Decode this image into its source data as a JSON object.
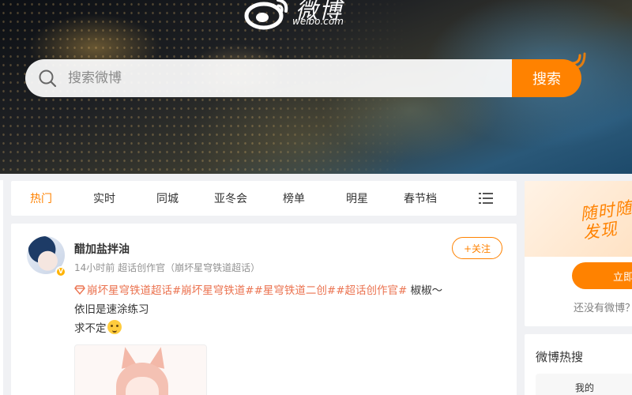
{
  "header": {
    "logo_cn": "微博",
    "logo_en": "weibo.com",
    "search_placeholder": "搜索微博",
    "search_button": "搜索"
  },
  "tabs": [
    {
      "label": "热门",
      "active": true
    },
    {
      "label": "实时",
      "active": false
    },
    {
      "label": "同城",
      "active": false
    },
    {
      "label": "亚冬会",
      "active": false
    },
    {
      "label": "榜单",
      "active": false
    },
    {
      "label": "明星",
      "active": false
    },
    {
      "label": "春节档",
      "active": false
    }
  ],
  "post": {
    "username": "醋加盐拌油",
    "meta": "14小时前  超话创作官（崩坏星穹铁道超话）",
    "follow_label": "+关注",
    "topic_text": "崩坏星穹铁道超话#崩坏星穹铁道##星穹铁道二创##超话创作官#",
    "text_after_topic": " 椒椒～",
    "line2": "依旧是速涂练习",
    "line3": "求不定"
  },
  "sidebar": {
    "promo_line1": "随时随",
    "promo_line2": "发现",
    "login_label": "立即",
    "no_account": "还没有微博？",
    "hot_title": "微博热搜",
    "hot_tab": "我的"
  },
  "colors": {
    "accent": "#ff8200",
    "topic": "#eb7350"
  },
  "icons": [
    "weibo-logo-icon",
    "search-icon",
    "signal-icon",
    "menu-icon",
    "diamond-icon",
    "emoji-icon",
    "verified-badge-icon"
  ]
}
